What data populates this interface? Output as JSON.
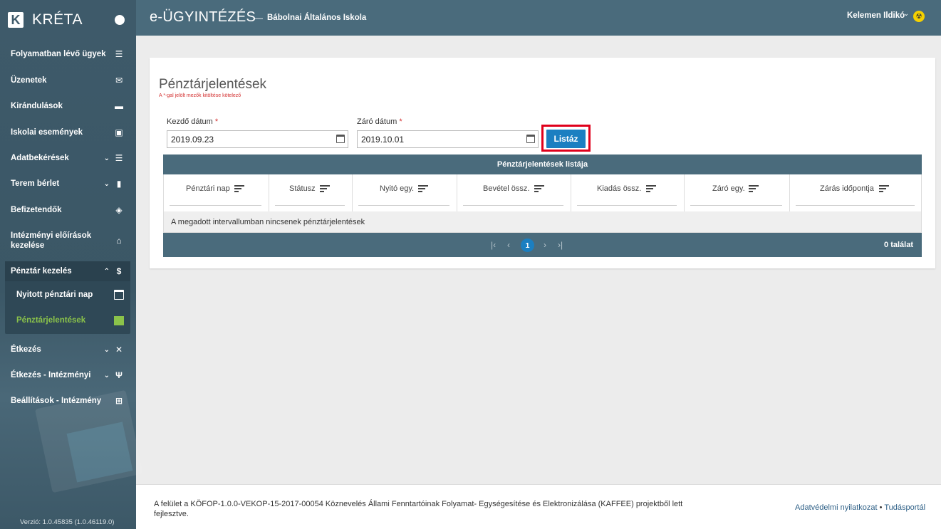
{
  "sidebar": {
    "brand": "KRÉTA",
    "logo_letter": "K",
    "items": [
      {
        "label": "Folyamatban lévő ügyek"
      },
      {
        "label": "Üzenetek"
      },
      {
        "label": "Kirándulások"
      },
      {
        "label": "Iskolai események"
      },
      {
        "label": "Adatbekérések"
      },
      {
        "label": "Terem bérlet"
      },
      {
        "label": "Befizetendők"
      },
      {
        "label": "Intézményi előírások kezelése"
      },
      {
        "label": "Pénztár kezelés"
      },
      {
        "label": "Étkezés"
      },
      {
        "label": "Étkezés - Intézményi"
      },
      {
        "label": "Beállítások - Intézmény"
      }
    ],
    "subitems": [
      {
        "label": "Nyitott pénztári nap"
      },
      {
        "label": "Pénztárjelentések"
      }
    ],
    "version": "Verzió: 1.0.45835 (1.0.46119.0)"
  },
  "header": {
    "title": "e-ÜGYINTÉZÉS",
    "dash": "—",
    "school": "Bábolnai Általános Iskola",
    "user": "Kelemen Ildikó"
  },
  "page": {
    "title": "Pénztárjelentések",
    "required_note": "A *-gal jelölt mezők kitöltése kötelező",
    "start_label": "Kezdő dátum",
    "end_label": "Záró dátum",
    "required_star": "*",
    "start_value": "2019.09.23",
    "end_value": "2019.10.01",
    "list_button": "Listáz"
  },
  "grid": {
    "title": "Pénztárjelentések listája",
    "columns": [
      "Pénztári nap",
      "Státusz",
      "Nyitó egy.",
      "Bevétel össz.",
      "Kiadás össz.",
      "Záró egy.",
      "Zárás időpontja"
    ],
    "empty_message": "A megadott intervallumban nincsenek pénztárjelentések",
    "current_page": "1",
    "result_count": "0 találat"
  },
  "footer": {
    "text": "A felület a KÖFOP-1.0.0-VEKOP-15-2017-00054 Köznevelés Állami Fenntartóinak Folyamat- Egységesítése és Elektronizálása (KAFFEE) projektből lett fejlesztve.",
    "privacy_link": "Adatvédelmi nyilatkozat",
    "separator": "•",
    "knowledge_link": "Tudásportál"
  },
  "colors": {
    "sidebar": "#3e5a6a",
    "header": "#4a6b7c",
    "primary_button": "#1b7fc1",
    "highlight": "#e0001b",
    "active_submenu": "#8bc34a"
  }
}
